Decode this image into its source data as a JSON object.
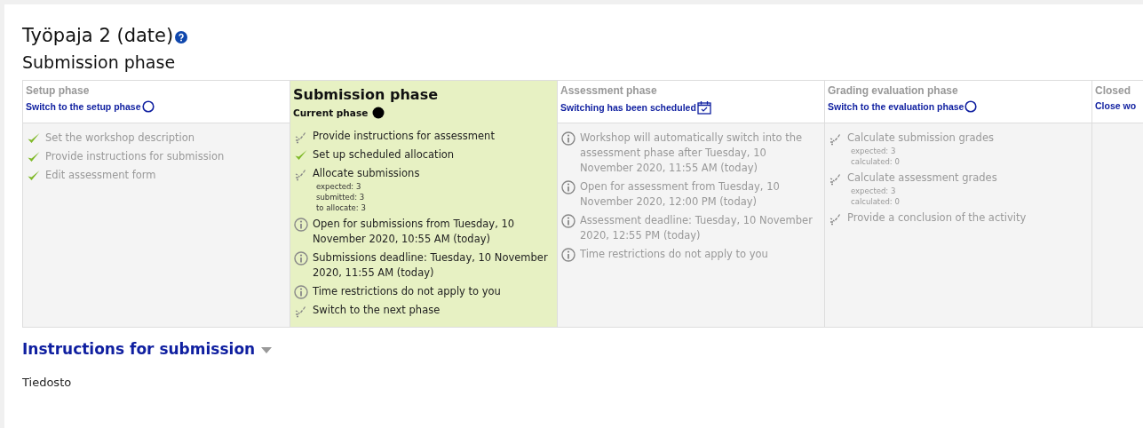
{
  "title": "Työpaja 2 (date)",
  "subtitle": "Submission phase",
  "phases": [
    {
      "name": "Setup phase",
      "current": false,
      "action": {
        "label": "Switch to the setup phase",
        "kind": "switch"
      },
      "tasks": [
        {
          "kind": "done",
          "text": "Set the workshop description"
        },
        {
          "kind": "done",
          "text": "Provide instructions for submission"
        },
        {
          "kind": "done",
          "text": "Edit assessment form"
        }
      ]
    },
    {
      "name": "Submission phase",
      "current": true,
      "action": {
        "label": "Current phase",
        "kind": "current"
      },
      "tasks": [
        {
          "kind": "todo",
          "text": "Provide instructions for assessment"
        },
        {
          "kind": "done",
          "text": "Set up scheduled allocation"
        },
        {
          "kind": "todo",
          "text": "Allocate submissions",
          "details": [
            "expected: 3",
            "submitted: 3",
            "to allocate: 3"
          ]
        },
        {
          "kind": "info",
          "text": "Open for submissions from Tuesday, 10 November 2020, 10:55 AM (today)"
        },
        {
          "kind": "info",
          "text": "Submissions deadline: Tuesday, 10 November 2020, 11:55 AM (today)"
        },
        {
          "kind": "info",
          "text": "Time restrictions do not apply to you"
        },
        {
          "kind": "todo",
          "text": "Switch to the next phase"
        }
      ]
    },
    {
      "name": "Assessment phase",
      "current": false,
      "action": {
        "label": "Switching has been scheduled",
        "kind": "scheduled"
      },
      "tasks": [
        {
          "kind": "info",
          "text": "Workshop will automatically switch into the assessment phase after Tuesday, 10 November 2020, 11:55 AM (today)"
        },
        {
          "kind": "info",
          "text": "Open for assessment from Tuesday, 10 November 2020, 12:00 PM (today)"
        },
        {
          "kind": "info",
          "text": "Assessment deadline: Tuesday, 10 November 2020, 12:55 PM (today)"
        },
        {
          "kind": "info",
          "text": "Time restrictions do not apply to you"
        }
      ]
    },
    {
      "name": "Grading evaluation phase",
      "current": false,
      "action": {
        "label": "Switch to the evaluation phase",
        "kind": "switch"
      },
      "tasks": [
        {
          "kind": "todo",
          "text": "Calculate submission grades",
          "details": [
            "expected: 3",
            "calculated: 0"
          ]
        },
        {
          "kind": "todo",
          "text": "Calculate assessment grades",
          "details": [
            "expected: 3",
            "calculated: 0"
          ]
        },
        {
          "kind": "todo",
          "text": "Provide a conclusion of the activity"
        }
      ]
    },
    {
      "name": "Closed",
      "current": false,
      "action": {
        "label": "Close wo",
        "kind": "none"
      }
    }
  ],
  "section": {
    "title": "Instructions for submission",
    "expanded": true,
    "content": "Tiedosto"
  }
}
